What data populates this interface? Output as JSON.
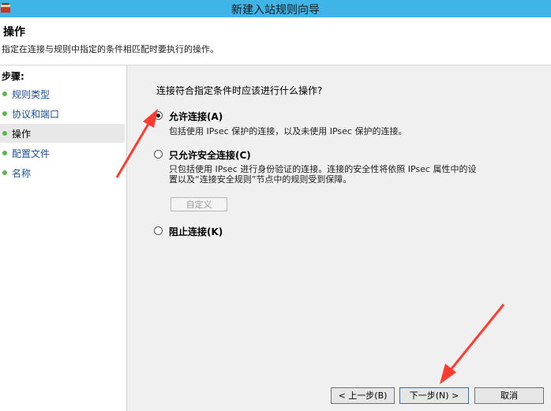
{
  "window": {
    "title": "新建入站规则向导"
  },
  "header": {
    "title": "操作",
    "subtitle": "指定在连接与规则中指定的条件相匹配时要执行的操作。"
  },
  "sidebar": {
    "steps_label": "步骤:",
    "items": [
      {
        "label": "规则类型"
      },
      {
        "label": "协议和端口"
      },
      {
        "label": "操作"
      },
      {
        "label": "配置文件"
      },
      {
        "label": "名称"
      }
    ]
  },
  "main": {
    "question": "连接符合指定条件时应该进行什么操作?",
    "options": [
      {
        "label": "允许连接(A)",
        "description": "包括使用 IPsec 保护的连接，以及未使用 IPsec 保护的连接。",
        "selected": true
      },
      {
        "label": "只允许安全连接(C)",
        "description_line1": "只包括使用 IPsec 进行身份验证的连接。连接的安全性将依照 IPsec 属性中的设",
        "description_line2": "置以及“连接安全规则”节点中的规则受到保障。",
        "selected": false
      },
      {
        "label": "阻止连接(K)",
        "selected": false
      }
    ],
    "customize_label": "自定义"
  },
  "buttons": {
    "back": "< 上一步(B)",
    "next": "下一步(N) >",
    "cancel": "取消"
  },
  "colors": {
    "titlebar": "#3fb4e6",
    "step_dot": "#58b84c",
    "step_link": "#1b4f9c",
    "annotation_arrow": "#ff3b2f"
  }
}
